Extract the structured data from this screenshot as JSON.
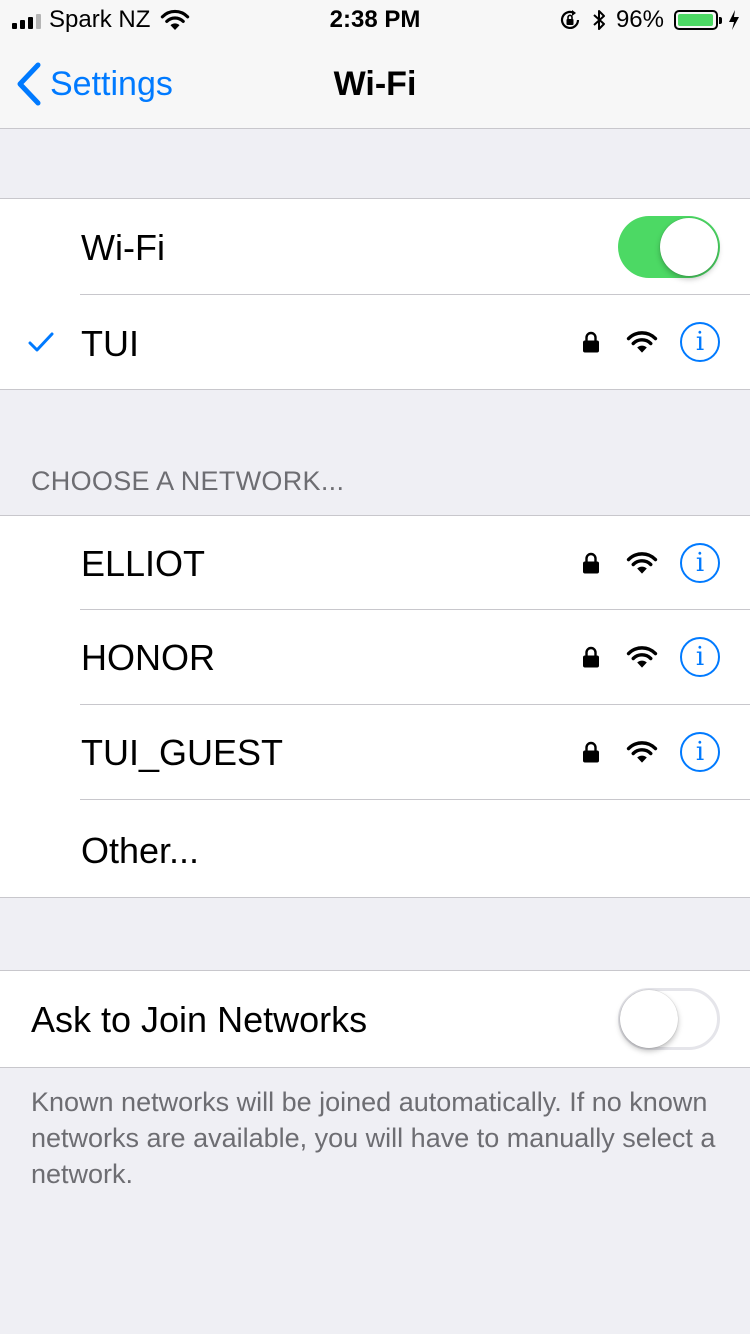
{
  "status_bar": {
    "carrier": "Spark NZ",
    "time": "2:38 PM",
    "battery_percent": "96%",
    "battery_level": 0.96,
    "icons": [
      "cellular-signal-icon",
      "wifi-icon",
      "orientation-lock-icon",
      "bluetooth-icon",
      "battery-icon",
      "charging-bolt-icon"
    ]
  },
  "nav": {
    "back_label": "Settings",
    "title": "Wi-Fi"
  },
  "wifi_toggle": {
    "label": "Wi-Fi",
    "on": true
  },
  "connected_network": {
    "name": "TUI",
    "secured": true,
    "icons": [
      "checkmark-icon",
      "lock-icon",
      "wifi-signal-icon",
      "info-icon"
    ]
  },
  "networks_header": "CHOOSE A NETWORK...",
  "networks": [
    {
      "name": "ELLIOT",
      "secured": true
    },
    {
      "name": "HONOR",
      "secured": true
    },
    {
      "name": "TUI_GUEST",
      "secured": true
    }
  ],
  "other_label": "Other...",
  "ask_to_join": {
    "label": "Ask to Join Networks",
    "on": false
  },
  "footer": "Known networks will be joined automatically. If no known networks are available, you will have to manually select a network.",
  "colors": {
    "accent": "#007aff",
    "toggle_on": "#4cd964",
    "background": "#efeff4",
    "secondary_text": "#6d6d72"
  }
}
